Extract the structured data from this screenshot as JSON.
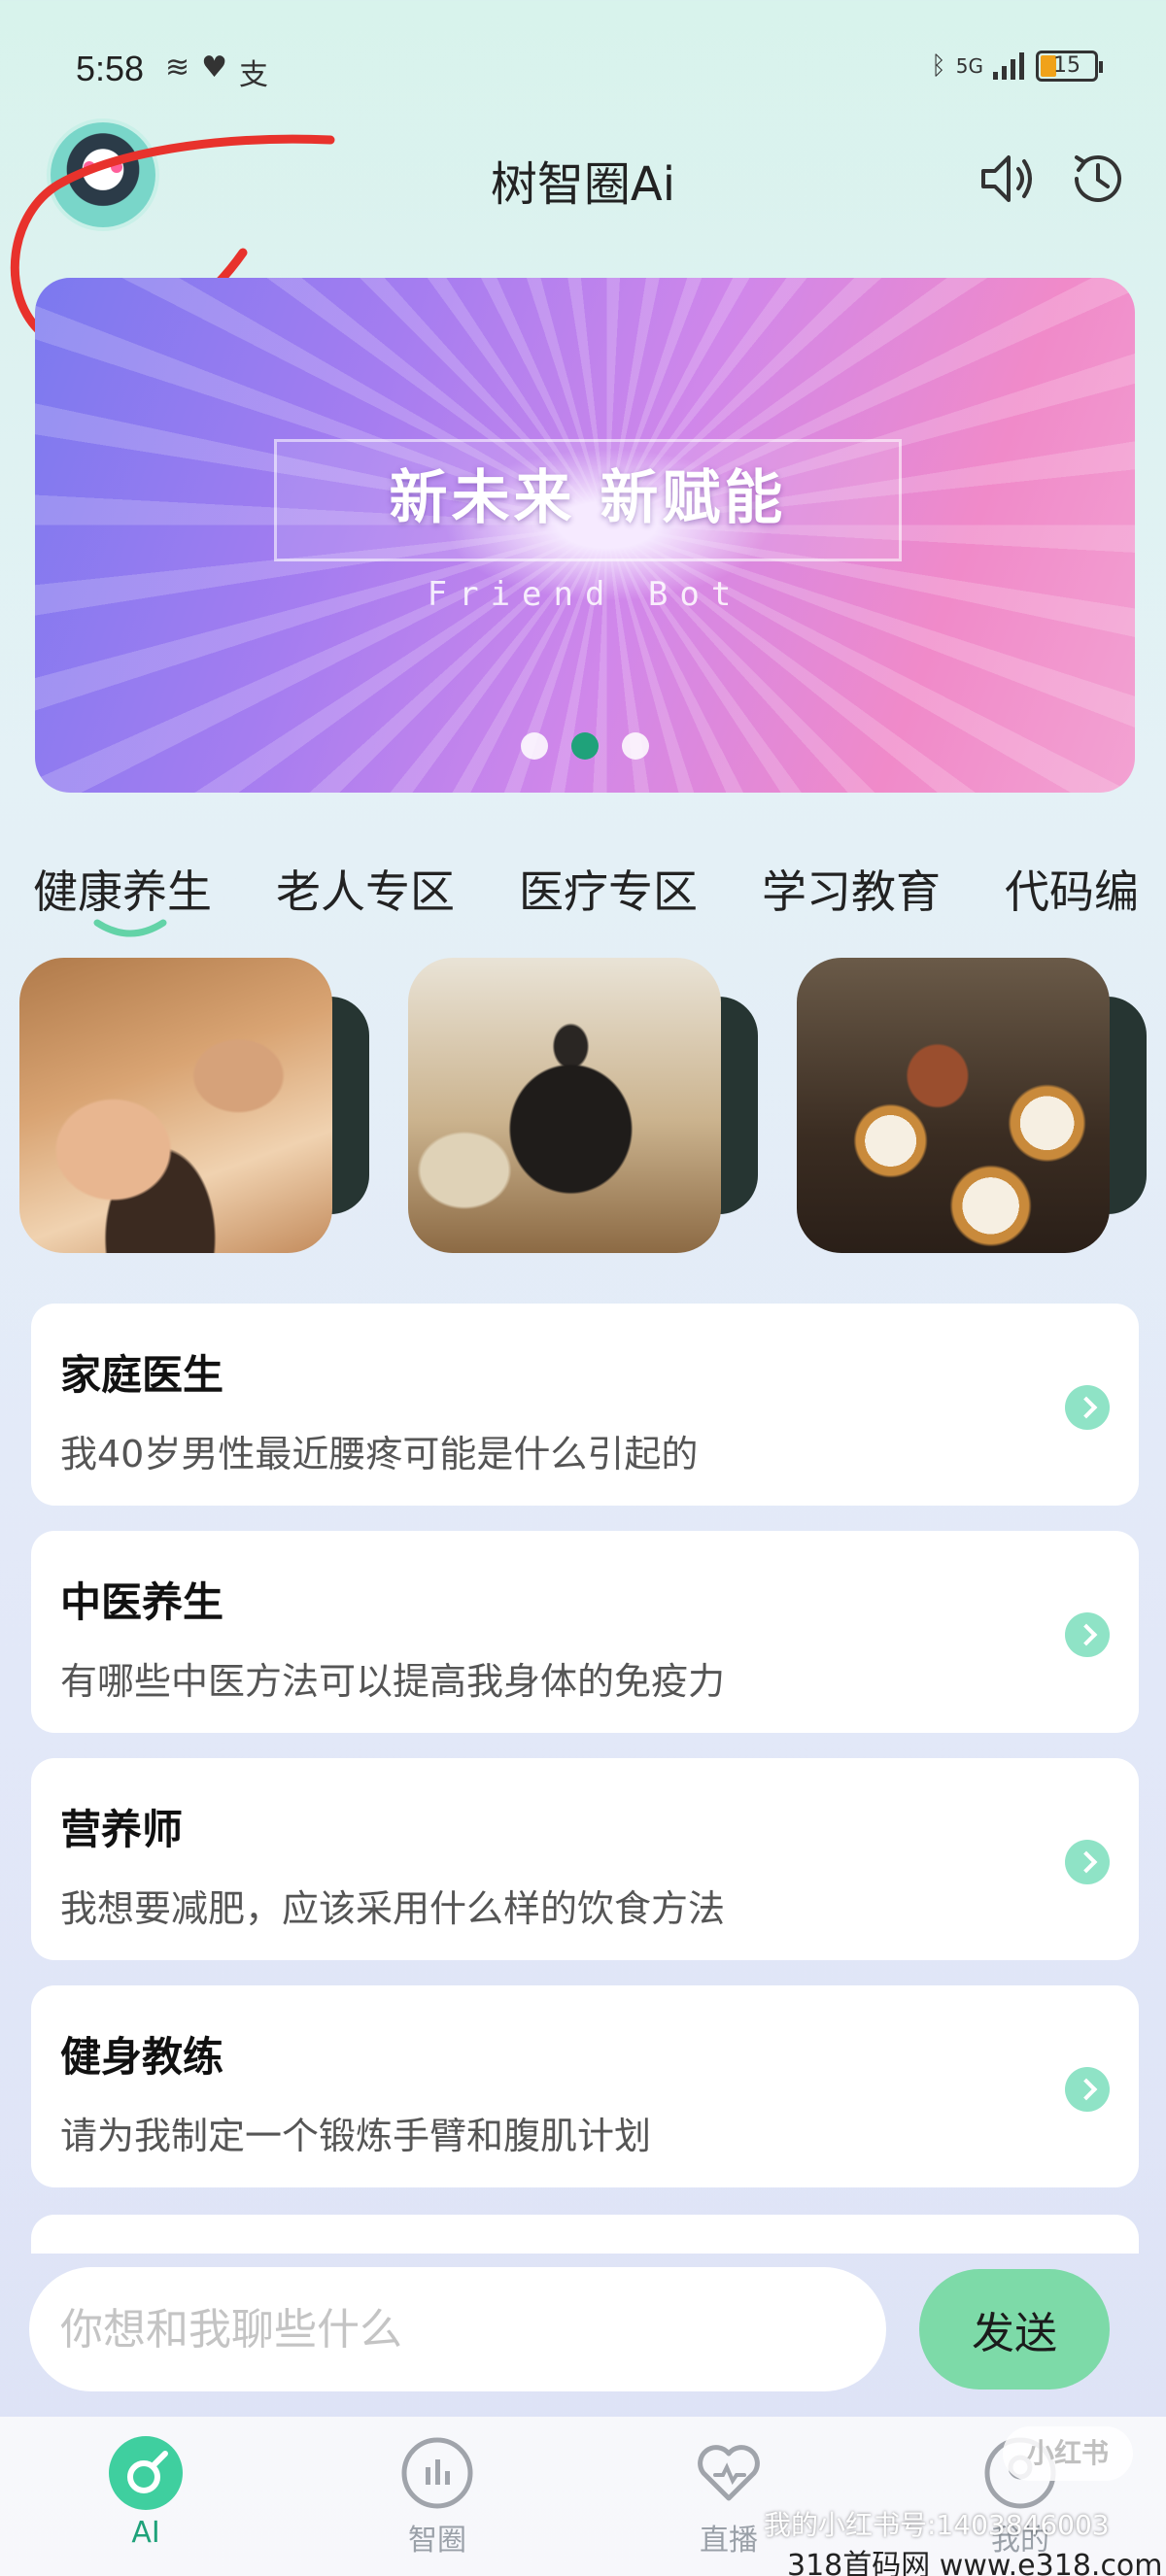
{
  "status_bar": {
    "time": "5:58",
    "left_icons": [
      "≋",
      "♥",
      "支"
    ],
    "network": "5G",
    "battery": "15"
  },
  "header": {
    "title": "树智圈Ai"
  },
  "banner": {
    "headline": "新未来 新赋能",
    "subtitle": "Friend Bot",
    "page_index": 2,
    "page_count": 3
  },
  "tabs": [
    {
      "label": "健康养生",
      "active": true
    },
    {
      "label": "老人专区",
      "active": false
    },
    {
      "label": "医疗专区",
      "active": false
    },
    {
      "label": "学习教育",
      "active": false
    },
    {
      "label": "代码编",
      "active": false
    }
  ],
  "prompts": [
    {
      "title": "家庭医生",
      "question": "我40岁男性最近腰疼可能是什么引起的"
    },
    {
      "title": "中医养生",
      "question": "有哪些中医方法可以提高我身体的免疫力"
    },
    {
      "title": "营养师",
      "question": "我想要减肥，应该采用什么样的饮食方法"
    },
    {
      "title": "健身教练",
      "question": "请为我制定一个锻炼手臂和腹肌计划"
    }
  ],
  "chat": {
    "placeholder": "你想和我聊些什么",
    "send_label": "发送"
  },
  "bottom_nav": [
    {
      "label": "AI",
      "active": true
    },
    {
      "label": "智圈",
      "active": false
    },
    {
      "label": "直播",
      "active": false
    },
    {
      "label": "我的",
      "active": false
    }
  ],
  "watermark": {
    "badge": "小红书",
    "account": "我的小红书号:1403846003",
    "site": "318首码网 www.e318.com"
  },
  "colors": {
    "accent": "#1fa27a",
    "send_button": "#7ddaa8",
    "card_arrow": "#8fe3c6"
  }
}
